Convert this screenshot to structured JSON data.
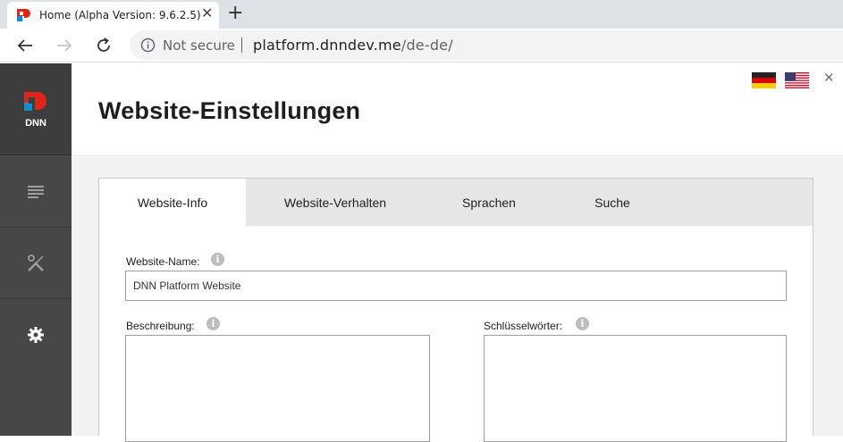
{
  "browser": {
    "tab_title": "Home (Alpha Version: 9.6.2.5)",
    "tab_close": "✕",
    "new_tab": "+",
    "security_label": "Not secure",
    "url_host": "platform.dnndev.me",
    "url_path": "/de-de/"
  },
  "app": {
    "logo_text": "DNN",
    "page_title": "Website-Einstellungen",
    "close": "✕",
    "languages": [
      "de-DE",
      "en-US"
    ]
  },
  "nav": {
    "items": [
      "content-icon",
      "tools-icon",
      "settings-icon"
    ]
  },
  "tabs": [
    {
      "label": "Website-Info",
      "active": true
    },
    {
      "label": "Website-Verhalten",
      "active": false
    },
    {
      "label": "Sprachen",
      "active": false
    },
    {
      "label": "Suche",
      "active": false
    }
  ],
  "form": {
    "site_name_label": "Website-Name:",
    "site_name_value": "DNN Platform Website",
    "description_label": "Beschreibung:",
    "description_value": "",
    "keywords_label": "Schlüsselwörter:",
    "keywords_value": "",
    "help_glyph": "i"
  },
  "colors": {
    "dnn_red": "#e2231a",
    "dnn_blue": "#0d8fd7",
    "sidebar": "#474747",
    "tab_bar": "#e5e6e6"
  }
}
